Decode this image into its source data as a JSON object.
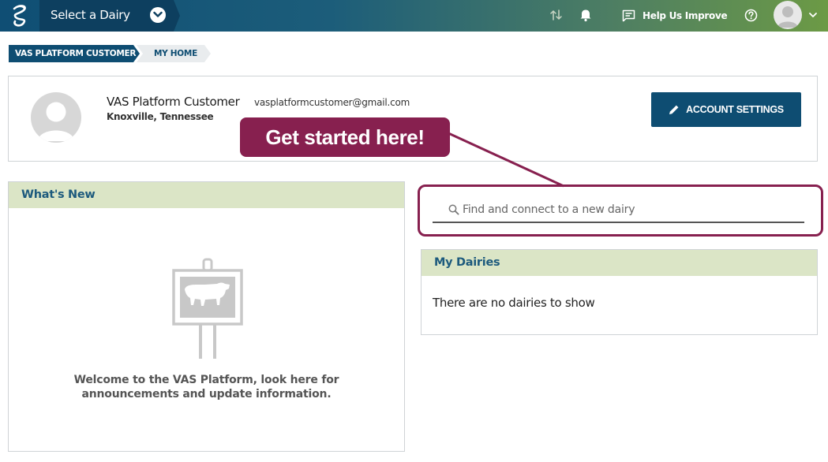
{
  "header": {
    "dairy_select_label": "Select a Dairy",
    "help_improve_label": "Help Us Improve"
  },
  "breadcrumb": {
    "items": [
      {
        "label": "VAS PLATFORM CUSTOMER"
      },
      {
        "label": "MY HOME"
      }
    ]
  },
  "profile": {
    "name": "VAS Platform Customer",
    "location": "Knoxville, Tennessee",
    "email": "vasplatformcustomer@gmail.com",
    "account_settings_label": "ACCOUNT SETTINGS"
  },
  "callout": {
    "text": "Get started here!"
  },
  "whats_new": {
    "title": "What's New",
    "welcome": "Welcome to the VAS Platform, look here for announcements and update information."
  },
  "search": {
    "placeholder": "Find and connect to a new dairy"
  },
  "my_dairies": {
    "title": "My Dairies",
    "empty_message": "There are no dairies to show"
  },
  "colors": {
    "primary": "#0e4d72",
    "panel_header": "#dbe5c6",
    "callout": "#87204f"
  },
  "icons": [
    "logo-icon",
    "chevron-down-icon",
    "sync-icon",
    "bell-icon",
    "feedback-icon",
    "help-icon",
    "user-avatar-icon",
    "pencil-icon",
    "search-icon",
    "cow-sign-icon"
  ]
}
